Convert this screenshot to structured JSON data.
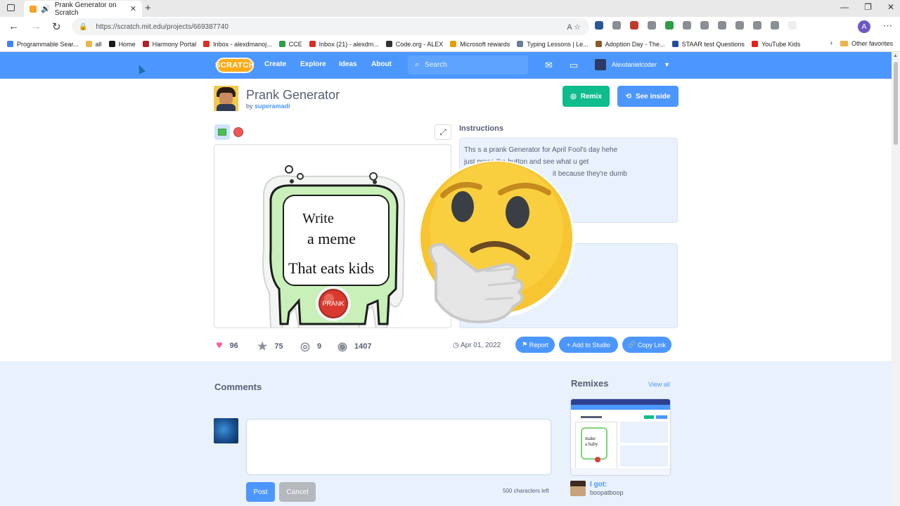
{
  "browser": {
    "tab_title": "Prank Generator on Scratch",
    "url": "https://scratch.mit.edu/projects/669387740",
    "bookmarks": [
      {
        "label": "Programmable Sear...",
        "color": "#4285f4"
      },
      {
        "label": "all",
        "color": "#e8b64c"
      },
      {
        "label": "Home",
        "color": "#1a1a1a"
      },
      {
        "label": "Harmony Portal",
        "color": "#b0232a"
      },
      {
        "label": "Inbox - alexdmanoj...",
        "color": "#d93025"
      },
      {
        "label": "CCE",
        "color": "#2f9e44"
      },
      {
        "label": "Inbox (21) - alexdm...",
        "color": "#d93025"
      },
      {
        "label": "Code.org - ALEX",
        "color": "#333333"
      },
      {
        "label": "Microsoft rewards",
        "color": "#e0a100"
      },
      {
        "label": "Typing Lessons | Le...",
        "color": "#6a7f9a"
      },
      {
        "label": "Adoption Day - The...",
        "color": "#8a5a2b"
      },
      {
        "label": "STAAR test Questions",
        "color": "#1f4e9c"
      },
      {
        "label": "YouTube Kids",
        "color": "#e62117"
      }
    ],
    "other_favorites": "Other favorites",
    "profile_initial": "A"
  },
  "nav": {
    "logo": "SCRATCH",
    "links": [
      "Create",
      "Explore",
      "Ideas",
      "About"
    ],
    "search_placeholder": "Search",
    "username": "Alexdanielcoder"
  },
  "project": {
    "title": "Prank Generator",
    "by_prefix": "by",
    "author": "superamadi",
    "remix_label": "Remix",
    "see_inside_label": "See inside",
    "stage": {
      "line1": "Write",
      "line2": "a meme",
      "line3": "That eats kids",
      "button": "PRANK"
    },
    "instructions_label": "Instructions",
    "instructions_lines": [
      "Ths s a prank Generator for April Fool's day hehe",
      "just press the button and see what u get",
      "it because they're dumb"
    ],
    "stats": {
      "loves": "96",
      "favorites": "75",
      "remixes": "9",
      "views": "1407"
    },
    "date": "Apr 01, 2022",
    "report_label": "Report",
    "add_studio_label": "Add to Studio",
    "copy_link_label": "Copy Link"
  },
  "comments": {
    "title": "Comments",
    "post_label": "Post",
    "cancel_label": "Cancel",
    "chars_left": "500 characters left"
  },
  "remixes": {
    "title": "Remixes",
    "view_all": "View all",
    "item": {
      "name": "I got:",
      "user": "boopatboop",
      "thumb_text_1": "make",
      "thumb_text_2": "a baby"
    }
  },
  "colors": {
    "scratch_blue": "#4c97ff",
    "remix_green": "#0fbd8c",
    "light_panel": "#e9f1fc"
  }
}
